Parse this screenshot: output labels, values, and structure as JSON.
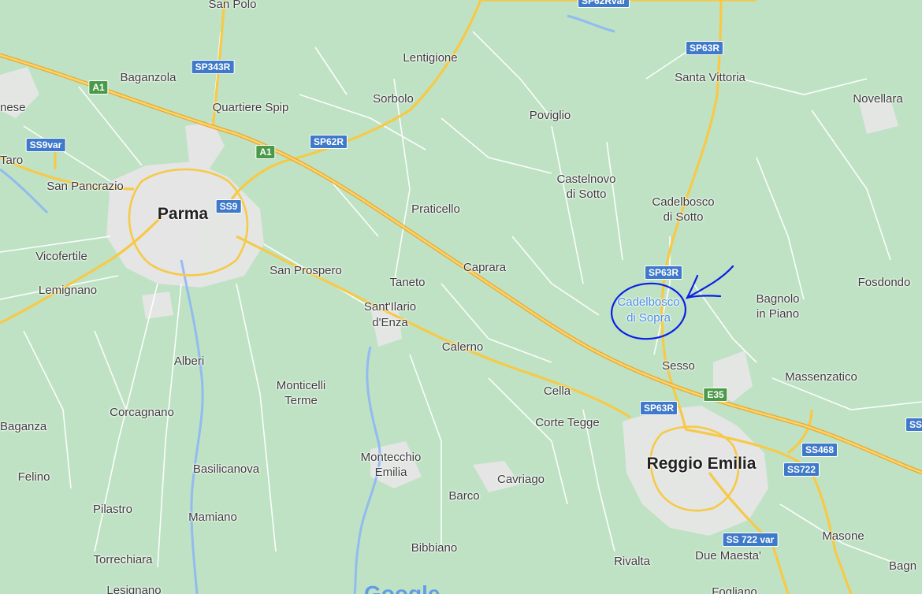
{
  "places": {
    "san_polo": "San Polo",
    "lentigione": "Lentigione",
    "baganzola": "Baganzola",
    "quartiere_spip": "Quartiere Spip",
    "sorbolo": "Sorbolo",
    "poviglio": "Poviglio",
    "santa_vittoria": "Santa Vittoria",
    "novellara": "Novellara",
    "nese": "nese",
    "taro": "Taro",
    "san_pancrazio": "San Pancrazio",
    "parma": "Parma",
    "castelnovo_sotto_1": "Castelnovo",
    "castelnovo_sotto_2": "di Sotto",
    "cadelbosco_sotto_1": "Cadelbosco",
    "cadelbosco_sotto_2": "di Sotto",
    "praticello": "Praticello",
    "vicofertile": "Vicofertile",
    "san_prospero": "San Prospero",
    "caprara": "Caprara",
    "taneto": "Taneto",
    "lemignano": "Lemignano",
    "cadelbosco_sopra_1": "Cadelbosco",
    "cadelbosco_sopra_2": "di Sopra",
    "bagnolo_1": "Bagnolo",
    "bagnolo_2": "in Piano",
    "fosdondo": "Fosdondo",
    "santilario_1": "Sant'Ilario",
    "santilario_2": "d'Enza",
    "calerno": "Calerno",
    "alberi": "Alberi",
    "sesso": "Sesso",
    "massenzatico": "Massenzatico",
    "monticelli_1": "Monticelli",
    "monticelli_2": "Terme",
    "cella": "Cella",
    "corcagnano": "Corcagnano",
    "corte_tegge": "Corte Tegge",
    "baganza": "Baganza",
    "reggio_emilia": "Reggio Emilia",
    "montecchio_1": "Montecchio",
    "montecchio_2": "Emilia",
    "basilicanova": "Basilicanova",
    "felino": "Felino",
    "cavriago": "Cavriago",
    "barco": "Barco",
    "pilastro": "Pilastro",
    "mamiano": "Mamiano",
    "masone": "Masone",
    "bibbiano": "Bibbiano",
    "torrechiara": "Torrechiara",
    "rivalta": "Rivalta",
    "due_maesta": "Due Maesta'",
    "bagn": "Bagn",
    "lesignano": "Lesignano",
    "fogliano": "Fogliano"
  },
  "shields": {
    "sp62rvar": "SP62Rvar",
    "sp63r_top": "SP63R",
    "sp343r": "SP343R",
    "a1_left": "A1",
    "ss9var": "SS9var",
    "sp62r": "SP62R",
    "a1_mid": "A1",
    "ss9": "SS9",
    "sp63r_mid": "SP63R",
    "e35": "E35",
    "sp63r_low": "SP63R",
    "ss468": "SS468",
    "ss722": "SS722",
    "ss722var": "SS 722 var",
    "ss_edge": "SS"
  },
  "attribution": "Google",
  "colors": {
    "land": "#bfe2c4",
    "urban": "#e8e8e8",
    "road": "#ffffff",
    "highway": "#f7c948",
    "motorway": "#f2b93b",
    "water": "#8ab4f8",
    "annotation": "#0b1ee6"
  }
}
